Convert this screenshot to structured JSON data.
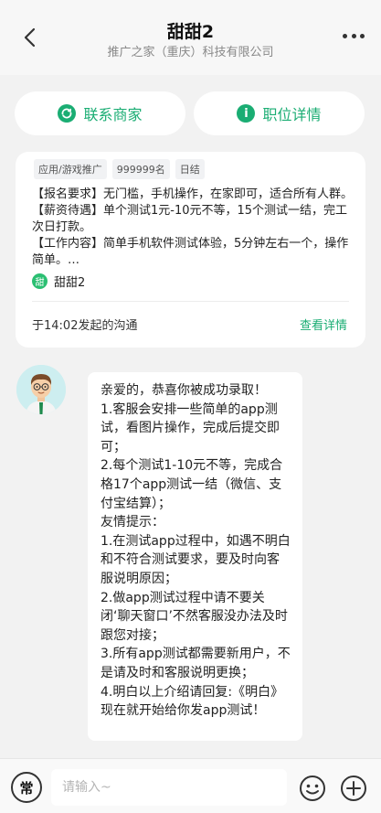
{
  "header": {
    "title": "甜甜2",
    "subtitle": "推广之家（重庆）科技有限公司"
  },
  "actions": {
    "contact_label": "联系商家",
    "detail_label": "职位详情"
  },
  "job_card": {
    "tags": [
      "应用/游戏推广",
      "999999名",
      "日结"
    ],
    "description": "【报名要求】无门槛，手机操作，在家即可，适合所有人群。\n【薪资待遇】单个测试1元-10元不等，15个测试一结，完工次日打款。\n【工作内容】简单手机软件测试体验，5分钟左右一个，操作简单。…",
    "recruiter_badge": "甜",
    "recruiter_name": "甜甜2",
    "chat_time": "于14:02发起的沟通",
    "view_detail": "查看详情"
  },
  "chat": {
    "message": "亲爱的，恭喜你被成功录取！\n1.客服会安排一些简单的app测试，看图片操作，完成后提交即可；\n2.每个测试1-10元不等，完成合格17个app测试一结（微信、支付宝结算）；\n友情提示：\n1.在测试app过程中，如遇不明白和不符合测试要求，要及时向客服说明原因；\n2.做app测试过程中请不要关闭‘聊天窗口’不然客服没办法及时跟您对接；\n3.所有app测试都需要新用户，不是请及时和客服说明更换；\n4.明白以上介绍请回复:《明白》\n现在就开始给你发app测试！"
  },
  "input_bar": {
    "common_label": "常",
    "placeholder": "请输入~"
  },
  "colors": {
    "accent": "#1aad73",
    "background": "#f2f2f2"
  }
}
